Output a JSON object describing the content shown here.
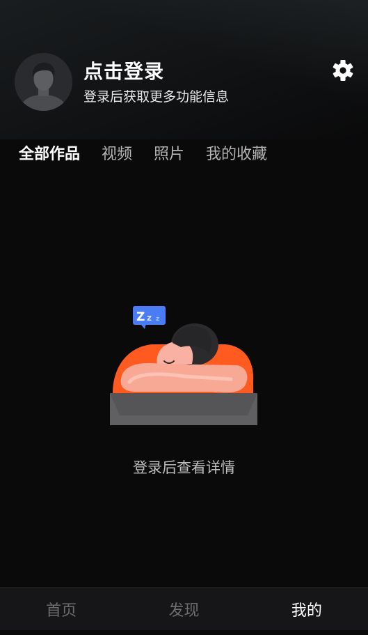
{
  "header": {
    "title": "点击登录",
    "subtitle": "登录后获取更多功能信息",
    "avatar_icon": "user-avatar-icon",
    "settings_icon": "gear-icon"
  },
  "tabs": [
    {
      "label": "全部作品",
      "active": true
    },
    {
      "label": "视频",
      "active": false
    },
    {
      "label": "照片",
      "active": false
    },
    {
      "label": "我的收藏",
      "active": false
    }
  ],
  "empty_state": {
    "illustration": "sleeping-person-illustration",
    "bubble_text": "Zzz",
    "message": "登录后查看详情"
  },
  "bottom_nav": [
    {
      "label": "首页",
      "active": false
    },
    {
      "label": "发现",
      "active": false
    },
    {
      "label": "我的",
      "active": true
    }
  ],
  "colors": {
    "background": "#0a0a0b",
    "accent_orange": "#ff5a1f",
    "bubble_blue": "#4a7cf6",
    "nav_bg": "#161618",
    "inactive_text": "#6d6d70"
  }
}
